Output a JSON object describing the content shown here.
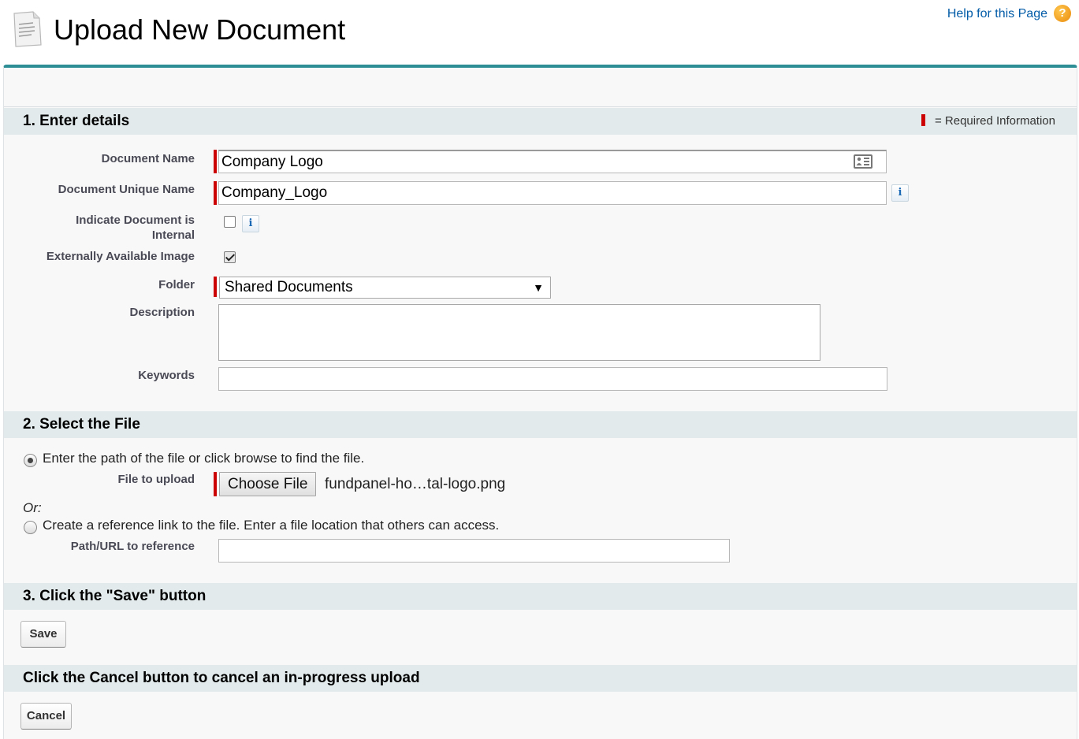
{
  "header": {
    "title": "Upload New Document",
    "help_link": "Help for this Page",
    "help_icon_glyph": "?"
  },
  "section1": {
    "title": "1. Enter details",
    "required_legend": "= Required Information",
    "fields": {
      "document_name": {
        "label": "Document Name",
        "value": "Company Logo",
        "required": true
      },
      "unique_name": {
        "label": "Document Unique Name",
        "value": "Company_Logo",
        "required": true
      },
      "internal": {
        "label_line1": "Indicate Document is",
        "label_line2": "Internal",
        "checked": false
      },
      "external_image": {
        "label": "Externally Available Image",
        "checked": true
      },
      "folder": {
        "label": "Folder",
        "selected": "Shared Documents",
        "required": true
      },
      "description": {
        "label": "Description",
        "value": ""
      },
      "keywords": {
        "label": "Keywords",
        "value": ""
      }
    },
    "info_glyph": "i"
  },
  "section2": {
    "title": "2. Select the File",
    "option_path": "Enter the path of the file or click browse to find the file.",
    "file_label": "File to upload",
    "choose_button": "Choose File",
    "file_name": "fundpanel-ho…tal-logo.png",
    "or_text": "Or:",
    "option_reference": "Create a reference link to the file. Enter a file location that others can access.",
    "path_label": "Path/URL to reference",
    "path_value": ""
  },
  "section3": {
    "title": "3. Click the \"Save\" button",
    "save_button": "Save"
  },
  "section4": {
    "title": "Click the Cancel button to cancel an in-progress upload",
    "cancel_button": "Cancel"
  },
  "colors": {
    "accent": "#2d8e96",
    "required": "#cc0000",
    "link": "#015ba7",
    "section_bg": "#e3eaeb"
  }
}
